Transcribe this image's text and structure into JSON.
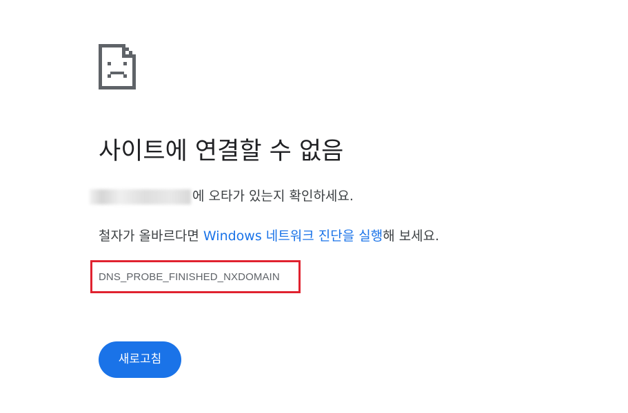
{
  "icon": {
    "name": "sad-page-icon"
  },
  "title": "사이트에 연결할 수 없음",
  "typo_line": {
    "domain_redacted": "",
    "text": "에 오타가 있는지 확인하세요."
  },
  "diagnostics_line": {
    "prefix": "철자가 올바르다면 ",
    "link_text": "Windows 네트워크 진단을 실행",
    "suffix": "해 보세요."
  },
  "error_code": "DNS_PROBE_FINISHED_NXDOMAIN",
  "reload_button": {
    "label": "새로고침"
  },
  "colors": {
    "link": "#1a73e8",
    "button_bg": "#1a73e8",
    "highlight_border": "#e0222f",
    "icon": "#5f6368"
  }
}
